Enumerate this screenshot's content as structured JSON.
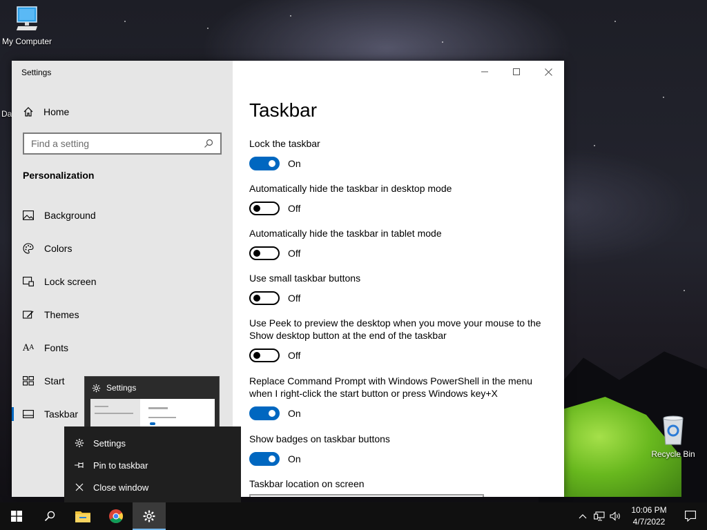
{
  "desktop": {
    "icons": [
      {
        "label": "My Computer",
        "icon": "computer-icon"
      },
      {
        "label": "Recycle Bin",
        "icon": "recycle-bin-icon"
      }
    ],
    "partial_icon_label": "Da"
  },
  "settings_window": {
    "app_title": "Settings",
    "nav": {
      "home_label": "Home",
      "search_placeholder": "Find a setting",
      "section_title": "Personalization",
      "items": [
        {
          "label": "Background",
          "icon": "picture-icon"
        },
        {
          "label": "Colors",
          "icon": "palette-icon"
        },
        {
          "label": "Lock screen",
          "icon": "lock-screen-icon"
        },
        {
          "label": "Themes",
          "icon": "themes-icon"
        },
        {
          "label": "Fonts",
          "icon": "fonts-icon"
        },
        {
          "label": "Start",
          "icon": "start-icon"
        },
        {
          "label": "Taskbar",
          "icon": "taskbar-icon",
          "active": true
        }
      ]
    },
    "page_title": "Taskbar",
    "settings": [
      {
        "label": "Lock the taskbar",
        "state": "On"
      },
      {
        "label": "Automatically hide the taskbar in desktop mode",
        "state": "Off"
      },
      {
        "label": "Automatically hide the taskbar in tablet mode",
        "state": "Off"
      },
      {
        "label": "Use small taskbar buttons",
        "state": "Off"
      },
      {
        "label": "Use Peek to preview the desktop when you move your mouse to the Show desktop button at the end of the taskbar",
        "state": "Off"
      },
      {
        "label": "Replace Command Prompt with Windows PowerShell in the menu when I right-click the start button or press Windows key+X",
        "state": "On"
      },
      {
        "label": "Show badges on taskbar buttons",
        "state": "On"
      }
    ],
    "location_label": "Taskbar location on screen"
  },
  "thumbnail": {
    "title": "Settings"
  },
  "jump_list": {
    "items": [
      {
        "label": "Settings",
        "icon": "gear-icon"
      },
      {
        "label": "Pin to taskbar",
        "icon": "pin-icon"
      },
      {
        "label": "Close window",
        "icon": "close-icon"
      }
    ]
  },
  "taskbar": {
    "apps": [
      "start-button",
      "search-button",
      "file-explorer",
      "chrome",
      "settings"
    ],
    "clock": {
      "time": "10:06 PM",
      "date": "4/7/2022"
    }
  },
  "colors": {
    "accent": "#0067c0",
    "nav_bg": "#e6e6e6",
    "taskbar_bg": "#101010",
    "tent": "#68b81e"
  }
}
